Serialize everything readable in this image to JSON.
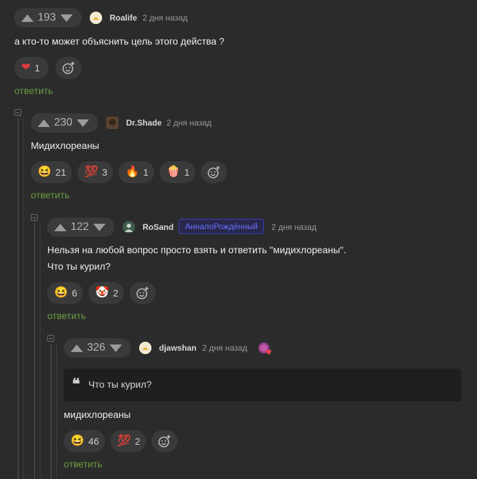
{
  "comments": [
    {
      "score": "193",
      "user": "Roalife",
      "time": "2 дня назад",
      "text": "а кто-то может объяснить цель этого действа ?",
      "reactions": [
        {
          "emoji": "heart",
          "glyph": "❤",
          "count": "1"
        }
      ],
      "reply_label": "ответить"
    },
    {
      "score": "230",
      "user": "Dr.Shade",
      "time": "2 дня назад",
      "text": "Мидихлореаны",
      "reactions": [
        {
          "emoji": "grin",
          "glyph": "😆",
          "count": "21"
        },
        {
          "emoji": "hundred",
          "glyph": "💯",
          "count": "3"
        },
        {
          "emoji": "fire",
          "glyph": "🔥",
          "count": "1"
        },
        {
          "emoji": "popcorn",
          "glyph": "🍿",
          "count": "1"
        }
      ],
      "reply_label": "ответить"
    },
    {
      "score": "122",
      "user": "RoSand",
      "badge": "АнналоРождённый",
      "time": "2 дня назад",
      "text_lines": [
        "Нельзя на любой вопрос просто взять и ответить \"мидихлореаны\".",
        "Что ты курил?"
      ],
      "reactions": [
        {
          "emoji": "grin",
          "glyph": "😆",
          "count": "6"
        },
        {
          "emoji": "clown",
          "glyph": "🤡",
          "count": "2"
        }
      ],
      "reply_label": "ответить"
    },
    {
      "score": "326",
      "user": "djawshan",
      "time": "2 дня назад",
      "quote": "Что ты курил?",
      "text": "мидихлореаны",
      "reactions": [
        {
          "emoji": "grin",
          "glyph": "😆",
          "count": "46"
        },
        {
          "emoji": "hundred",
          "glyph": "💯",
          "count": "2"
        }
      ],
      "reply_label": "ответить"
    }
  ],
  "colors": {
    "background": "#2b2b2c",
    "reply": "#6a9e3f",
    "badge_text": "#6b70ff"
  }
}
